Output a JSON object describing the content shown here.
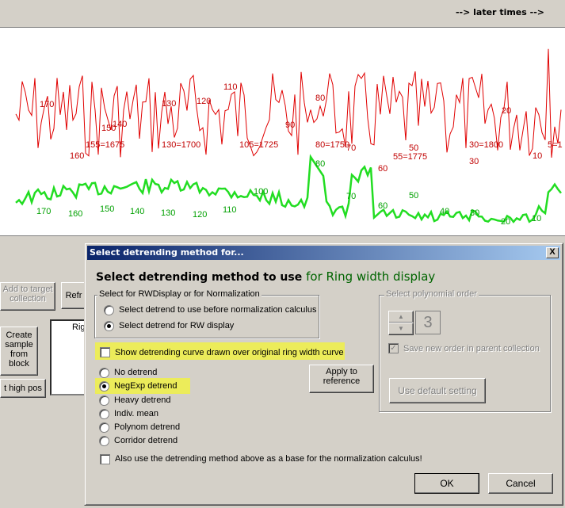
{
  "header": {
    "later_times": "--> later times -->"
  },
  "chart_data": {
    "type": "line",
    "series": [
      {
        "color": "#e00000"
      },
      {
        "color": "#22dd22"
      }
    ],
    "red_labels": [
      "170",
      "150",
      "140",
      "130",
      "120",
      "110",
      "160",
      "155=1675",
      "130=1700",
      "105=1725",
      "90",
      "80",
      "80=1750",
      "70",
      "50",
      "55=1775",
      "60",
      "30=1800",
      "20",
      "30",
      "10",
      "5=1"
    ],
    "green_labels": [
      "170",
      "160",
      "150",
      "140",
      "130",
      "120",
      "110",
      "100",
      "80",
      "70",
      "60",
      "50",
      "40",
      "30",
      "20",
      "10"
    ]
  },
  "parent": {
    "add_to_target": "Add to target collection",
    "refresh": "Refr",
    "create_sample": "Create sample from block",
    "high_pos": "t high pos",
    "list_item": "Rig"
  },
  "dialog": {
    "title": "Select detrending method for...",
    "close": "X",
    "heading_main": "Select detrending method to use",
    "heading_target": "for Ring width display",
    "group1_legend": "Select for RWDisplay or for Normalization",
    "opt_before_norm": "Select detrend to use before normalization calculus",
    "opt_rw_display": "Select detrend for RW display",
    "show_curve": "Show detrending curve drawn over original ring width curve",
    "methods": [
      "No detrend",
      "NegExp detrend",
      "Heavy detrend",
      "Indiv. mean",
      "Polynom detrend",
      "Corridor detrend"
    ],
    "apply_ref": "Apply to reference",
    "also_use": "Also use the detrending method above as a base for the normalization calculus!",
    "poly_legend": "Select polynomial order",
    "poly_value": "3",
    "save_order": "Save new order in parent collection",
    "use_default": "Use default setting",
    "ok": "OK",
    "cancel": "Cancel"
  }
}
